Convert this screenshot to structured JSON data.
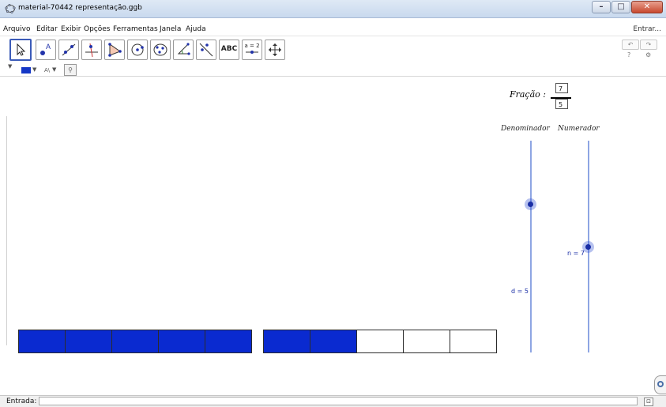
{
  "window": {
    "title": "material-70442 representação.ggb"
  },
  "menu": {
    "items": [
      "Arquivo",
      "Editar",
      "Exibir",
      "Opções",
      "Ferramentas",
      "Janela",
      "Ajuda"
    ],
    "login": "Entrar..."
  },
  "toolbar": {
    "tools": [
      "move-tool",
      "point-tool",
      "line-tool",
      "perpendicular-tool",
      "polygon-tool",
      "circle-tool",
      "conic-tool",
      "angle-tool",
      "reflect-tool",
      "text-tool",
      "slider-tool",
      "move-view-tool"
    ],
    "text_tool_label": "ABC",
    "slider_tool_label": "a = 2",
    "undo_label": "↶",
    "redo_label": "↷",
    "help_label": "?",
    "settings_label": "⚙"
  },
  "stylebar": {
    "color": "#1537c6",
    "text_size_label": "A\\"
  },
  "canvas": {
    "fraction_label": "Fração :",
    "numerator": "7",
    "denominator": "5",
    "slider_denominator_label": "Denominador",
    "slider_numerator_label": "Numerador",
    "slider_d_value": "d = 5",
    "slider_n_value": "n = 7",
    "d_level": 0.7,
    "n_level": 0.5,
    "bars": [
      {
        "cells": [
          "filled",
          "filled",
          "filled",
          "filled",
          "filled"
        ]
      },
      {
        "cells": [
          "filled",
          "filled",
          "empty",
          "empty",
          "empty"
        ]
      }
    ],
    "fill_color": "#0a2ad0"
  },
  "input": {
    "label": "Entrada:",
    "value": ""
  }
}
